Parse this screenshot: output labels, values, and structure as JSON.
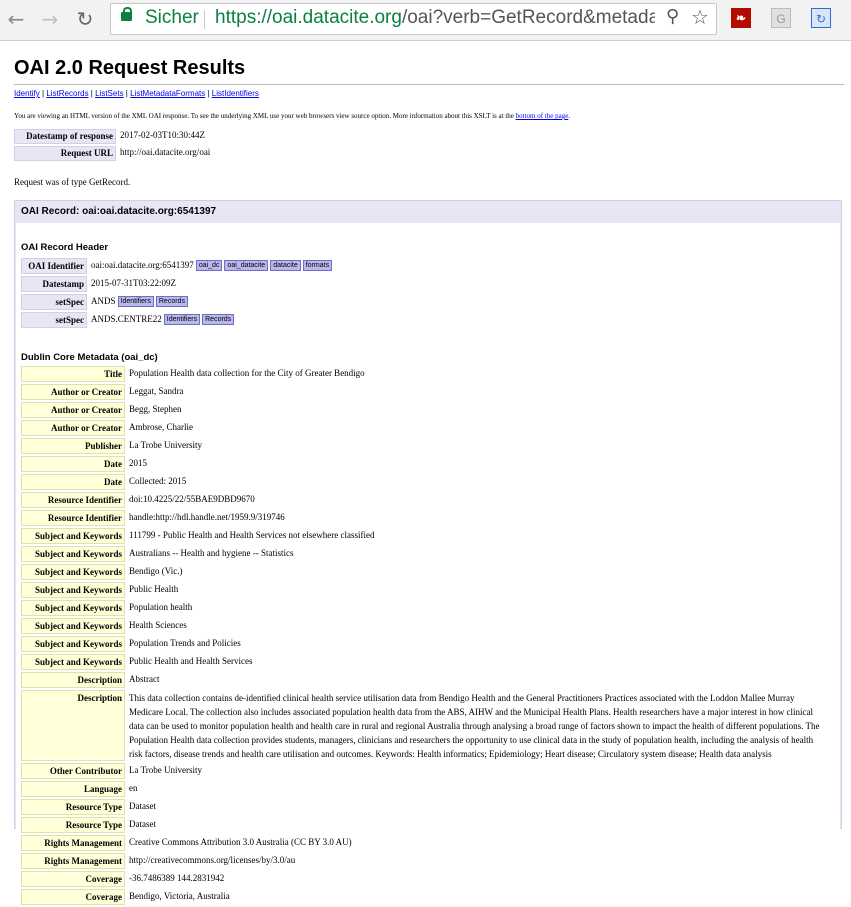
{
  "browser": {
    "secure_label": "Sicher",
    "url_host": "https://oai.datacite.org",
    "url_rest": "/oai?verb=GetRecord&metadataPr",
    "ext1": "",
    "ext2": "G",
    "ext3": ""
  },
  "page": {
    "title": "OAI 2.0 Request Results",
    "quicklinks": [
      "Identify",
      "ListRecords",
      "ListSets",
      "ListMetadataFormats",
      "ListIdentifiers"
    ],
    "intro_text": "You are viewing an HTML version of the XML OAI response. To see the underlying XML use your web browsers view source option. More information about this XSLT is at the ",
    "intro_link": "bottom of the page",
    "intro_end": ".",
    "response": {
      "datestamp_label": "Datestamp of response",
      "datestamp_value": "2017-02-03T10:30:44Z",
      "requrl_label": "Request URL",
      "requrl_value": "http://oai.datacite.org/oai"
    },
    "request_type": "Request was of type GetRecord."
  },
  "record": {
    "title": "OAI Record: oai:oai.datacite.org:6541397",
    "header_title": "OAI Record Header",
    "header": [
      {
        "label": "OAI Identifier",
        "value": "oai:oai.datacite.org:6541397",
        "tags": [
          "oai_dc",
          "oai_datacite",
          "datacite",
          "formats"
        ]
      },
      {
        "label": "Datestamp",
        "value": "2015-07-31T03:22:09Z",
        "tags": []
      },
      {
        "label": "setSpec",
        "value": "ANDS",
        "tags": [
          "Identifiers",
          "Records"
        ]
      },
      {
        "label": "setSpec",
        "value": "ANDS.CENTRE22",
        "tags": [
          "Identifiers",
          "Records"
        ]
      }
    ],
    "dc_title": "Dublin Core Metadata (oai_dc)",
    "dc": [
      {
        "label": "Title",
        "value": "Population Health data collection for the City of Greater Bendigo"
      },
      {
        "label": "Author or Creator",
        "value": "Leggat, Sandra"
      },
      {
        "label": "Author or Creator",
        "value": "Begg, Stephen"
      },
      {
        "label": "Author or Creator",
        "value": "Ambrose, Charlie"
      },
      {
        "label": "Publisher",
        "value": "La Trobe University"
      },
      {
        "label": "Date",
        "value": "2015"
      },
      {
        "label": "Date",
        "value": "Collected: 2015"
      },
      {
        "label": "Resource Identifier",
        "value": "doi:10.4225/22/55BAE9DBD9670"
      },
      {
        "label": "Resource Identifier",
        "value": "handle:http://hdl.handle.net/1959.9/319746"
      },
      {
        "label": "Subject and Keywords",
        "value": "111799 - Public Health and Health Services not elsewhere classified"
      },
      {
        "label": "Subject and Keywords",
        "value": "Australians -- Health and hygiene -- Statistics"
      },
      {
        "label": "Subject and Keywords",
        "value": "Bendigo (Vic.)"
      },
      {
        "label": "Subject and Keywords",
        "value": "Public Health"
      },
      {
        "label": "Subject and Keywords",
        "value": "Population health"
      },
      {
        "label": "Subject and Keywords",
        "value": "Health Sciences"
      },
      {
        "label": "Subject and Keywords",
        "value": "Population Trends and Policies"
      },
      {
        "label": "Subject and Keywords",
        "value": "Public Health and Health Services"
      },
      {
        "label": "Description",
        "value": "Abstract"
      },
      {
        "label": "Description",
        "value": "This data collection contains de-identified clinical health service utilisation data from Bendigo Health and the General Practitioners Practices associated with the Loddon Mallee Murray Medicare Local. The collection also includes associated population health data from the ABS, AIHW and the Municipal Health Plans. Health researchers have a major interest in how clinical data can be used to monitor population health and health care in rural and regional Australia through analysing a broad range of factors shown to impact the health of different populations. The Population Health data collection provides students, managers, clinicians and researchers the opportunity to use clinical data in the study of population health, including the analysis of health risk factors, disease trends and health care utilisation and outcomes. Keywords: Health informatics; Epidemiology; Heart disease; Circulatory system disease; Health data analysis",
        "long": true
      },
      {
        "label": "Other Contributor",
        "value": "La Trobe University"
      },
      {
        "label": "Language",
        "value": "en"
      },
      {
        "label": "Resource Type",
        "value": "Dataset"
      },
      {
        "label": "Resource Type",
        "value": "Dataset"
      },
      {
        "label": "Rights Management",
        "value": "Creative Commons Attribution 3.0 Australia (CC BY 3.0 AU)"
      },
      {
        "label": "Rights Management",
        "value": "http://creativecommons.org/licenses/by/3.0/au"
      },
      {
        "label": "Coverage",
        "value": "-36.7486389 144.2831942"
      },
      {
        "label": "Coverage",
        "value": "Bendigo, Victoria, Australia"
      }
    ]
  }
}
